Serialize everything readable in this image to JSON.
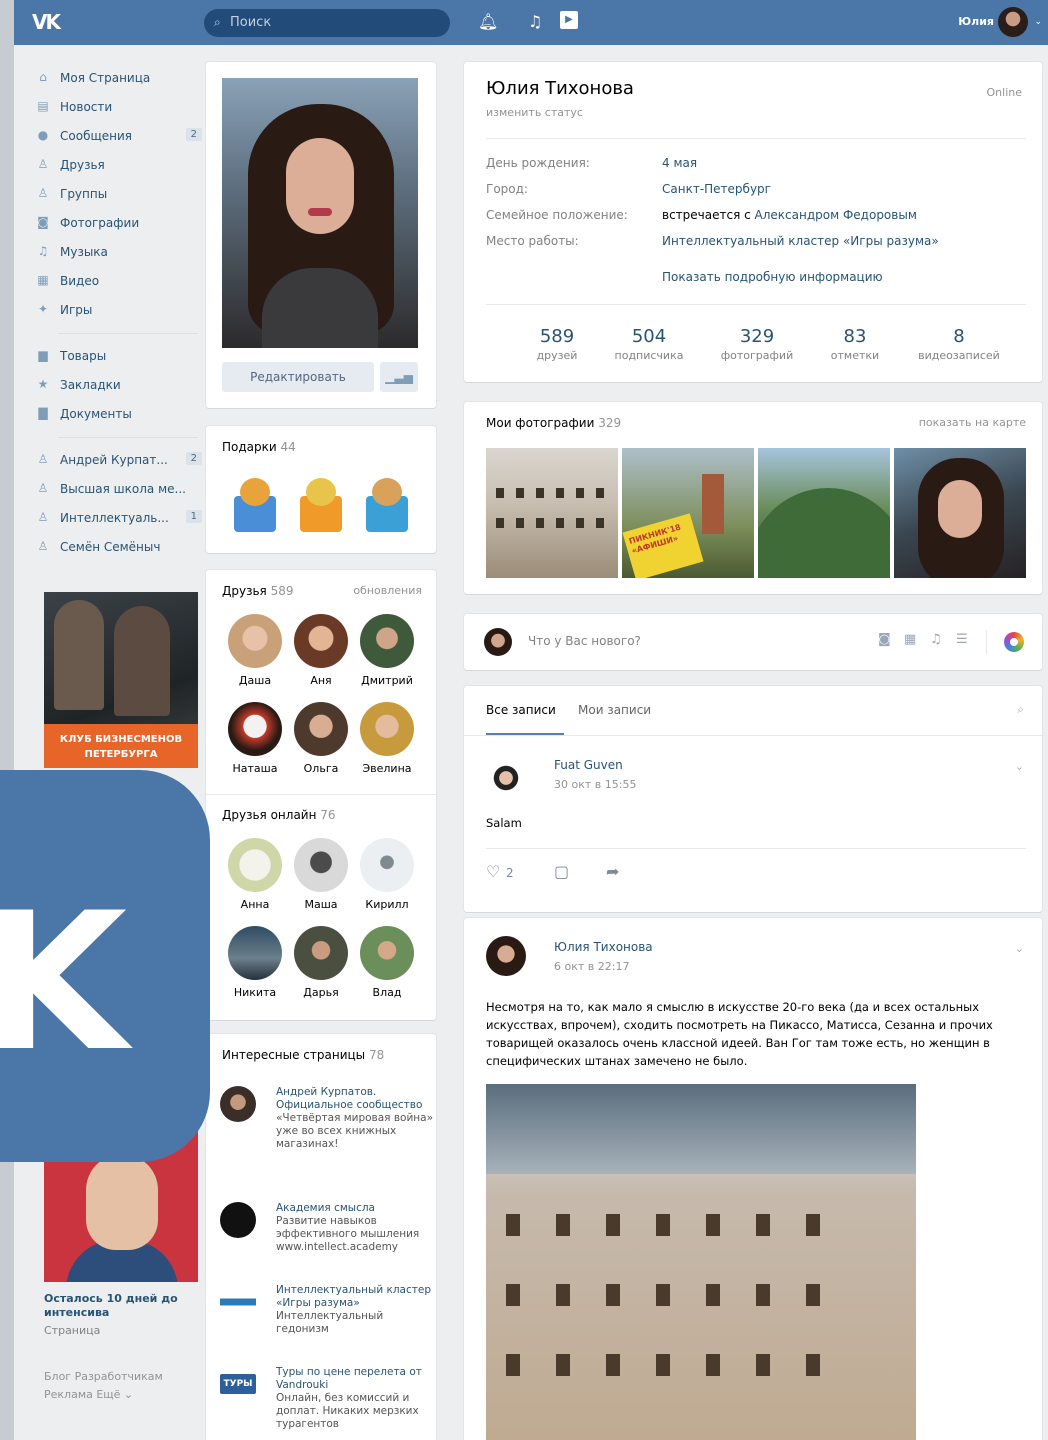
{
  "topbar": {
    "logo": "VK",
    "search_placeholder": "Поиск",
    "user_name": "Юлия"
  },
  "sidenav": {
    "items": [
      {
        "label": "Моя Страница",
        "icon": "home-icon",
        "badge": ""
      },
      {
        "label": "Новости",
        "icon": "news-icon",
        "badge": ""
      },
      {
        "label": "Сообщения",
        "icon": "messages-icon",
        "badge": "2"
      },
      {
        "label": "Друзья",
        "icon": "friends-icon",
        "badge": ""
      },
      {
        "label": "Группы",
        "icon": "groups-icon",
        "badge": ""
      },
      {
        "label": "Фотографии",
        "icon": "camera-icon",
        "badge": ""
      },
      {
        "label": "Музыка",
        "icon": "music-icon",
        "badge": ""
      },
      {
        "label": "Видео",
        "icon": "video-icon",
        "badge": ""
      },
      {
        "label": "Игры",
        "icon": "games-icon",
        "badge": ""
      }
    ],
    "items2": [
      {
        "label": "Товары",
        "icon": "shop-icon",
        "badge": ""
      },
      {
        "label": "Закладки",
        "icon": "star-icon",
        "badge": ""
      },
      {
        "label": "Документы",
        "icon": "document-icon",
        "badge": ""
      }
    ],
    "items3": [
      {
        "label": "Андрей Курпат...",
        "icon": "group-icon",
        "badge": "2"
      },
      {
        "label": "Высшая школа ме...",
        "icon": "group-icon",
        "badge": ""
      },
      {
        "label": "Интеллектуаль...",
        "icon": "group-icon",
        "badge": "1"
      },
      {
        "label": "Семён Семёныч",
        "icon": "group-icon",
        "badge": ""
      }
    ],
    "ad1_line1": "КЛУБ БИЗНЕСМЕНОВ",
    "ad1_line2": "ПЕТЕРБУРГА",
    "ad2_title": "Осталось 10 дней до интенсива",
    "ad2_sub": "Страница",
    "footer_line1": "Блог   Разработчикам",
    "footer_line2": "Реклама   Ещё ⌄"
  },
  "profile": {
    "edit_label": "Редактировать",
    "name": "Юлия Тихонова",
    "status": "изменить статус",
    "online": "Online",
    "info": [
      {
        "key": "День рождения:",
        "value": "4 мая",
        "plain": ""
      },
      {
        "key": "Город:",
        "value": "Санкт-Петербург",
        "plain": ""
      },
      {
        "key": "Семейное положение:",
        "value": "Александром Федоровым",
        "plain": "встречается с "
      },
      {
        "key": "Место работы:",
        "value": "Интеллектуальный кластер «Игры разума»",
        "plain": ""
      }
    ],
    "show_more": "Показать подробную информацию",
    "counters": [
      {
        "num": "589",
        "label": "друзей"
      },
      {
        "num": "504",
        "label": "подписчика"
      },
      {
        "num": "329",
        "label": "фотографий"
      },
      {
        "num": "83",
        "label": "отметки"
      },
      {
        "num": "8",
        "label": "видеозаписей"
      }
    ]
  },
  "gifts": {
    "title": "Подарки",
    "count": "44"
  },
  "friends": {
    "title": "Друзья",
    "count": "589",
    "updates": "обновления",
    "list": [
      "Даша",
      "Аня",
      "Дмитрий",
      "Наташа",
      "Ольга",
      "Эвелина"
    ],
    "online_title": "Друзья онлайн",
    "online_count": "76",
    "online_list": [
      "Анна",
      "Маша",
      "Кирилл",
      "Никита",
      "Дарья",
      "Влад"
    ]
  },
  "interesting": {
    "title": "Интересные страницы",
    "count": "78",
    "items": [
      {
        "name": "Андрей Курпатов. Официальное сообщество",
        "desc": "«Четвёртая мировая война» уже во всех книжных магазинах!"
      },
      {
        "name": "Академия смысла",
        "desc": "Развитие навыков эффективного мышления www.intellect.academy"
      },
      {
        "name": "Интеллектуальный кластер «Игры разума»",
        "desc": "Интеллектуальный гедонизм"
      },
      {
        "name": "Туры по цене перелета от Vandrouki",
        "desc": "Онлайн, без комиссий и доплат. Никаких мерзких турагентов"
      }
    ],
    "avatar_tour_label": "ТУРЫ"
  },
  "my_photos": {
    "title": "Мои фотографии",
    "count": "329",
    "map_link": "показать на карте",
    "sign_text": "ПИКНИК'18 «АФИШИ»"
  },
  "new_post": {
    "placeholder": "Что у Вас нового?"
  },
  "feed": {
    "tab_all": "Все записи",
    "tab_mine": "Мои записи",
    "post1": {
      "author": "Fuat Guven",
      "date": "30 окт в 15:55",
      "text": "Salam",
      "likes": "2"
    },
    "post2": {
      "author": "Юлия Тихонова",
      "date": "6 окт в 22:17",
      "text": "Несмотря на то, как мало я смыслю в искусстве 20-го века (да и всех остальных искусствах, впрочем), сходить посмотреть на Пикассо, Матисса, Сезанна и прочих товарищей оказалось очень классной идеей. Ван Гог там тоже есть, но женщин в специфических штанах замечено не было."
    }
  },
  "colors": {
    "brand": "#4a76a8",
    "link": "#285473",
    "background": "#edeef0"
  }
}
